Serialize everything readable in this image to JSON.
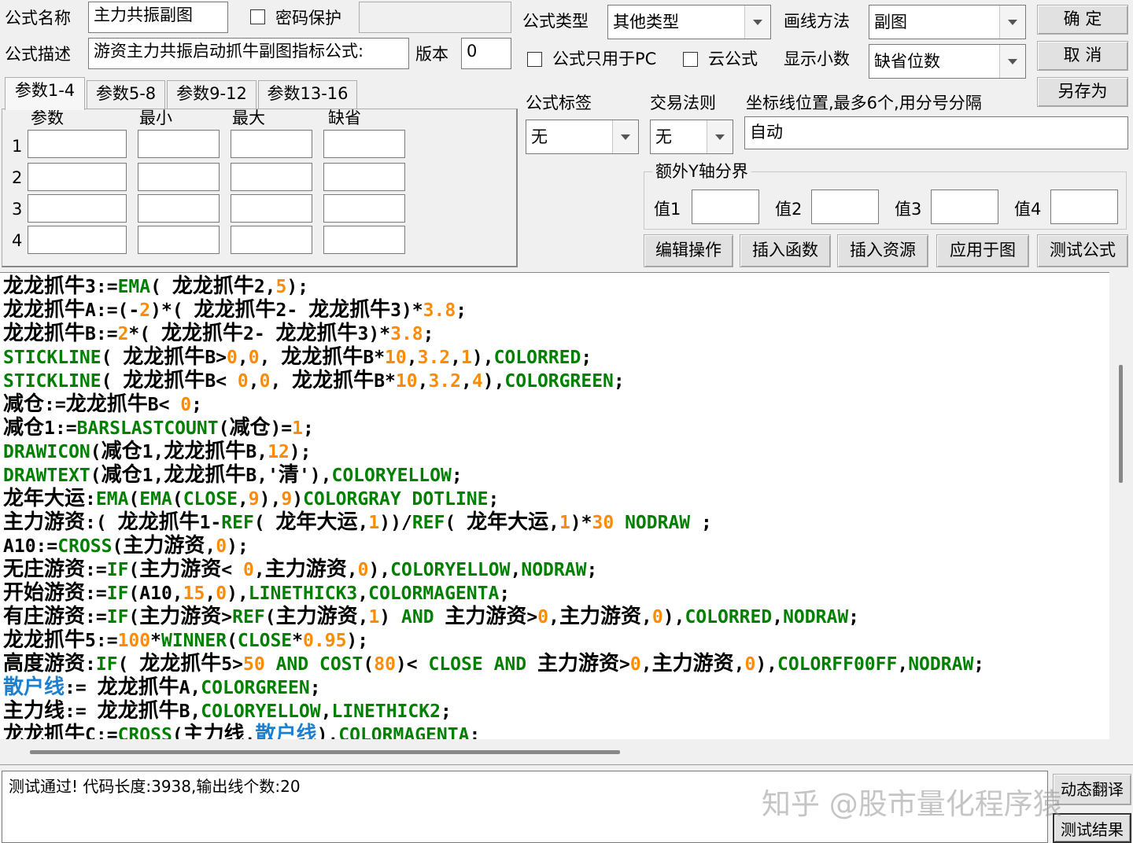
{
  "top": {
    "name_label": "公式名称",
    "name_value": "主力共振副图",
    "password_label": "密码保护",
    "desc_label": "公式描述",
    "desc_value": "游资主力共振启动抓牛副图指标公式:",
    "version_label": "版本",
    "version_value": "0"
  },
  "tabs": [
    "参数1-4",
    "参数5-8",
    "参数9-12",
    "参数13-16"
  ],
  "params": {
    "headers": [
      "参数",
      "最小",
      "最大",
      "缺省"
    ],
    "rows": [
      "1",
      "2",
      "3",
      "4"
    ]
  },
  "right": {
    "type_label": "公式类型",
    "type_value": "其他类型",
    "draw_label": "画线方法",
    "draw_value": "副图",
    "pc_only_label": "公式只用于PC",
    "cloud_label": "云公式",
    "decimal_label": "显示小数",
    "decimal_value": "缺省位数",
    "tag_label": "公式标签",
    "tag_value": "无",
    "rule_label": "交易法则",
    "rule_value": "无",
    "axis_label": "坐标线位置,最多6个,用分号分隔",
    "axis_value": "自动",
    "yaxis_title": "额外Y轴分界",
    "yvals": [
      "值1",
      "值2",
      "值3",
      "值4"
    ]
  },
  "buttons": {
    "ok": "确  定",
    "cancel": "取  消",
    "save_as": "另存为",
    "edit": "编辑操作",
    "insert_func": "插入函数",
    "insert_res": "插入资源",
    "apply": "应用于图",
    "test": "测试公式",
    "dyn_translate": "动态翻译",
    "test_result": "测试结果"
  },
  "code_lines": [
    [
      [
        "龙龙抓牛",
        "cn"
      ],
      [
        "3:=",
        "k"
      ],
      [
        "EMA",
        "g"
      ],
      [
        "( ",
        "k"
      ],
      [
        "龙龙抓牛",
        "cn"
      ],
      [
        "2,",
        "k"
      ],
      [
        "5",
        "o"
      ],
      [
        ");",
        "k"
      ]
    ],
    [
      [
        "龙龙抓牛",
        "cn"
      ],
      [
        "A:=(-",
        "k"
      ],
      [
        "2",
        "o"
      ],
      [
        ")*( ",
        "k"
      ],
      [
        "龙龙抓牛",
        "cn"
      ],
      [
        "2- ",
        "k"
      ],
      [
        "龙龙抓牛",
        "cn"
      ],
      [
        "3)*",
        "k"
      ],
      [
        "3.8",
        "o"
      ],
      [
        ";",
        "k"
      ]
    ],
    [
      [
        "龙龙抓牛",
        "cn"
      ],
      [
        "B:=",
        "k"
      ],
      [
        "2",
        "o"
      ],
      [
        "*( ",
        "k"
      ],
      [
        "龙龙抓牛",
        "cn"
      ],
      [
        "2- ",
        "k"
      ],
      [
        "龙龙抓牛",
        "cn"
      ],
      [
        "3)*",
        "k"
      ],
      [
        "3.8",
        "o"
      ],
      [
        ";",
        "k"
      ]
    ],
    [
      [
        "STICKLINE",
        "g"
      ],
      [
        "( ",
        "k"
      ],
      [
        "龙龙抓牛",
        "cn"
      ],
      [
        "B>",
        "k"
      ],
      [
        "0",
        "o"
      ],
      [
        ",",
        "k"
      ],
      [
        "0",
        "o"
      ],
      [
        ", ",
        "k"
      ],
      [
        "龙龙抓牛",
        "cn"
      ],
      [
        "B*",
        "k"
      ],
      [
        "10",
        "o"
      ],
      [
        ",",
        "k"
      ],
      [
        "3.2",
        "o"
      ],
      [
        ",",
        "k"
      ],
      [
        "1",
        "o"
      ],
      [
        "),",
        "k"
      ],
      [
        "COLORRED",
        "g"
      ],
      [
        ";",
        "k"
      ]
    ],
    [
      [
        "STICKLINE",
        "g"
      ],
      [
        "( ",
        "k"
      ],
      [
        "龙龙抓牛",
        "cn"
      ],
      [
        "B< ",
        "k"
      ],
      [
        "0",
        "o"
      ],
      [
        ",",
        "k"
      ],
      [
        "0",
        "o"
      ],
      [
        ", ",
        "k"
      ],
      [
        "龙龙抓牛",
        "cn"
      ],
      [
        "B*",
        "k"
      ],
      [
        "10",
        "o"
      ],
      [
        ",",
        "k"
      ],
      [
        "3.2",
        "o"
      ],
      [
        ",",
        "k"
      ],
      [
        "4",
        "o"
      ],
      [
        "),",
        "k"
      ],
      [
        "COLORGREEN",
        "g"
      ],
      [
        ";",
        "k"
      ]
    ],
    [
      [
        "减仓",
        "cn"
      ],
      [
        ":=",
        "k"
      ],
      [
        "龙龙抓牛",
        "cn"
      ],
      [
        "B< ",
        "k"
      ],
      [
        "0",
        "o"
      ],
      [
        ";",
        "k"
      ]
    ],
    [
      [
        "减仓",
        "cn"
      ],
      [
        "1:=",
        "k"
      ],
      [
        "BARSLASTCOUNT",
        "g"
      ],
      [
        "(",
        "k"
      ],
      [
        "减仓",
        "cn"
      ],
      [
        ")=",
        "k"
      ],
      [
        "1",
        "o"
      ],
      [
        ";",
        "k"
      ]
    ],
    [
      [
        "DRAWICON",
        "g"
      ],
      [
        "(",
        "k"
      ],
      [
        "减仓",
        "cn"
      ],
      [
        "1,",
        "k"
      ],
      [
        "龙龙抓牛",
        "cn"
      ],
      [
        "B,",
        "k"
      ],
      [
        "12",
        "o"
      ],
      [
        ");",
        "k"
      ]
    ],
    [
      [
        "DRAWTEXT",
        "g"
      ],
      [
        "(",
        "k"
      ],
      [
        "减仓",
        "cn"
      ],
      [
        "1,",
        "k"
      ],
      [
        "龙龙抓牛",
        "cn"
      ],
      [
        "B,'",
        "k"
      ],
      [
        "清",
        "cn"
      ],
      [
        "'),",
        "k"
      ],
      [
        "COLORYELLOW",
        "g"
      ],
      [
        ";",
        "k"
      ]
    ],
    [
      [
        "龙年大运",
        "cn"
      ],
      [
        ":",
        "k"
      ],
      [
        "EMA",
        "g"
      ],
      [
        "(",
        "k"
      ],
      [
        "EMA",
        "g"
      ],
      [
        "(",
        "k"
      ],
      [
        "CLOSE",
        "g"
      ],
      [
        ",",
        "k"
      ],
      [
        "9",
        "o"
      ],
      [
        "),",
        "k"
      ],
      [
        "9",
        "o"
      ],
      [
        ")",
        "k"
      ],
      [
        "COLORGRAY DOTLINE",
        "g"
      ],
      [
        ";",
        "k"
      ]
    ],
    [
      [
        "主力游资",
        "cn"
      ],
      [
        ":( ",
        "k"
      ],
      [
        "龙龙抓牛",
        "cn"
      ],
      [
        "1-",
        "k"
      ],
      [
        "REF",
        "g"
      ],
      [
        "( ",
        "k"
      ],
      [
        "龙年大运",
        "cn"
      ],
      [
        ",",
        "k"
      ],
      [
        "1",
        "o"
      ],
      [
        "))/",
        "k"
      ],
      [
        "REF",
        "g"
      ],
      [
        "( ",
        "k"
      ],
      [
        "龙年大运",
        "cn"
      ],
      [
        ",",
        "k"
      ],
      [
        "1",
        "o"
      ],
      [
        ")*",
        "k"
      ],
      [
        "30",
        "o"
      ],
      [
        " ",
        "k"
      ],
      [
        "NODRAW",
        "g"
      ],
      [
        " ;",
        "k"
      ]
    ],
    [
      [
        "A10:=",
        "k"
      ],
      [
        "CROSS",
        "g"
      ],
      [
        "(",
        "k"
      ],
      [
        "主力游资",
        "cn"
      ],
      [
        ",",
        "k"
      ],
      [
        "0",
        "o"
      ],
      [
        ");",
        "k"
      ]
    ],
    [
      [
        "无庄游资",
        "cn"
      ],
      [
        ":=",
        "k"
      ],
      [
        "IF",
        "g"
      ],
      [
        "(",
        "k"
      ],
      [
        "主力游资",
        "cn"
      ],
      [
        "< ",
        "k"
      ],
      [
        "0",
        "o"
      ],
      [
        ",",
        "k"
      ],
      [
        "主力游资",
        "cn"
      ],
      [
        ",",
        "k"
      ],
      [
        "0",
        "o"
      ],
      [
        "),",
        "k"
      ],
      [
        "COLORYELLOW",
        "g"
      ],
      [
        ",",
        "k"
      ],
      [
        "NODRAW",
        "g"
      ],
      [
        ";",
        "k"
      ]
    ],
    [
      [
        "开始游资",
        "cn"
      ],
      [
        ":=",
        "k"
      ],
      [
        "IF",
        "g"
      ],
      [
        "(A10,",
        "k"
      ],
      [
        "15",
        "o"
      ],
      [
        ",",
        "k"
      ],
      [
        "0",
        "o"
      ],
      [
        "),",
        "k"
      ],
      [
        "LINETHICK3",
        "g"
      ],
      [
        ",",
        "k"
      ],
      [
        "COLORMAGENTA",
        "g"
      ],
      [
        ";",
        "k"
      ]
    ],
    [
      [
        "有庄游资",
        "cn"
      ],
      [
        ":=",
        "k"
      ],
      [
        "IF",
        "g"
      ],
      [
        "(",
        "k"
      ],
      [
        "主力游资",
        "cn"
      ],
      [
        ">",
        "k"
      ],
      [
        "REF",
        "g"
      ],
      [
        "(",
        "k"
      ],
      [
        "主力游资",
        "cn"
      ],
      [
        ",",
        "k"
      ],
      [
        "1",
        "o"
      ],
      [
        ") ",
        "k"
      ],
      [
        "AND",
        "g"
      ],
      [
        " ",
        "k"
      ],
      [
        "主力游资",
        "cn"
      ],
      [
        ">",
        "k"
      ],
      [
        "0",
        "o"
      ],
      [
        ",",
        "k"
      ],
      [
        "主力游资",
        "cn"
      ],
      [
        ",",
        "k"
      ],
      [
        "0",
        "o"
      ],
      [
        "),",
        "k"
      ],
      [
        "COLORRED",
        "g"
      ],
      [
        ",",
        "k"
      ],
      [
        "NODRAW",
        "g"
      ],
      [
        ";",
        "k"
      ]
    ],
    [
      [
        "龙龙抓牛",
        "cn"
      ],
      [
        "5:=",
        "k"
      ],
      [
        "100",
        "o"
      ],
      [
        "*",
        "k"
      ],
      [
        "WINNER",
        "g"
      ],
      [
        "(",
        "k"
      ],
      [
        "CLOSE",
        "g"
      ],
      [
        "*",
        "k"
      ],
      [
        "0.95",
        "o"
      ],
      [
        ");",
        "k"
      ]
    ],
    [
      [
        "高度游资",
        "cn"
      ],
      [
        ":",
        "k"
      ],
      [
        "IF",
        "g"
      ],
      [
        "( ",
        "k"
      ],
      [
        "龙龙抓牛",
        "cn"
      ],
      [
        "5>",
        "k"
      ],
      [
        "50",
        "o"
      ],
      [
        " ",
        "k"
      ],
      [
        "AND",
        "g"
      ],
      [
        " ",
        "k"
      ],
      [
        "COST",
        "g"
      ],
      [
        "(",
        "k"
      ],
      [
        "80",
        "o"
      ],
      [
        ")< ",
        "k"
      ],
      [
        "CLOSE",
        "g"
      ],
      [
        " ",
        "k"
      ],
      [
        "AND",
        "g"
      ],
      [
        " ",
        "k"
      ],
      [
        "主力游资",
        "cn"
      ],
      [
        ">",
        "k"
      ],
      [
        "0",
        "o"
      ],
      [
        ",",
        "k"
      ],
      [
        "主力游资",
        "cn"
      ],
      [
        ",",
        "k"
      ],
      [
        "0",
        "o"
      ],
      [
        "),",
        "k"
      ],
      [
        "COLORFF00FF",
        "g"
      ],
      [
        ",",
        "k"
      ],
      [
        "NODRAW",
        "g"
      ],
      [
        ";",
        "k"
      ]
    ],
    [
      [
        "散户线",
        "cnb"
      ],
      [
        ":= ",
        "k"
      ],
      [
        "龙龙抓牛",
        "cn"
      ],
      [
        "A,",
        "k"
      ],
      [
        "COLORGREEN",
        "g"
      ],
      [
        ";",
        "k"
      ]
    ],
    [
      [
        "主力线",
        "cn"
      ],
      [
        ":= ",
        "k"
      ],
      [
        "龙龙抓牛",
        "cn"
      ],
      [
        "B,",
        "k"
      ],
      [
        "COLORYELLOW",
        "g"
      ],
      [
        ",",
        "k"
      ],
      [
        "LINETHICK2",
        "g"
      ],
      [
        ";",
        "k"
      ]
    ],
    [
      [
        "龙龙抓牛",
        "cn"
      ],
      [
        "C:=",
        "k"
      ],
      [
        "CROSS",
        "g"
      ],
      [
        "(",
        "k"
      ],
      [
        "主力线",
        "cn"
      ],
      [
        ",",
        "k"
      ],
      [
        "散户线",
        "cnb"
      ],
      [
        "),",
        "k"
      ],
      [
        "COLORMAGENTA",
        "g"
      ],
      [
        ";",
        "k"
      ]
    ]
  ],
  "code_colors": {
    "k": "#000000",
    "g": "#008000",
    "o": "#ff8c00",
    "cn": "#000000",
    "cnb": "#1e7fcf"
  },
  "result_text": "测试通过! 代码长度:3938,输出线个数:20",
  "watermark": "知乎 @股市量化程序猿"
}
